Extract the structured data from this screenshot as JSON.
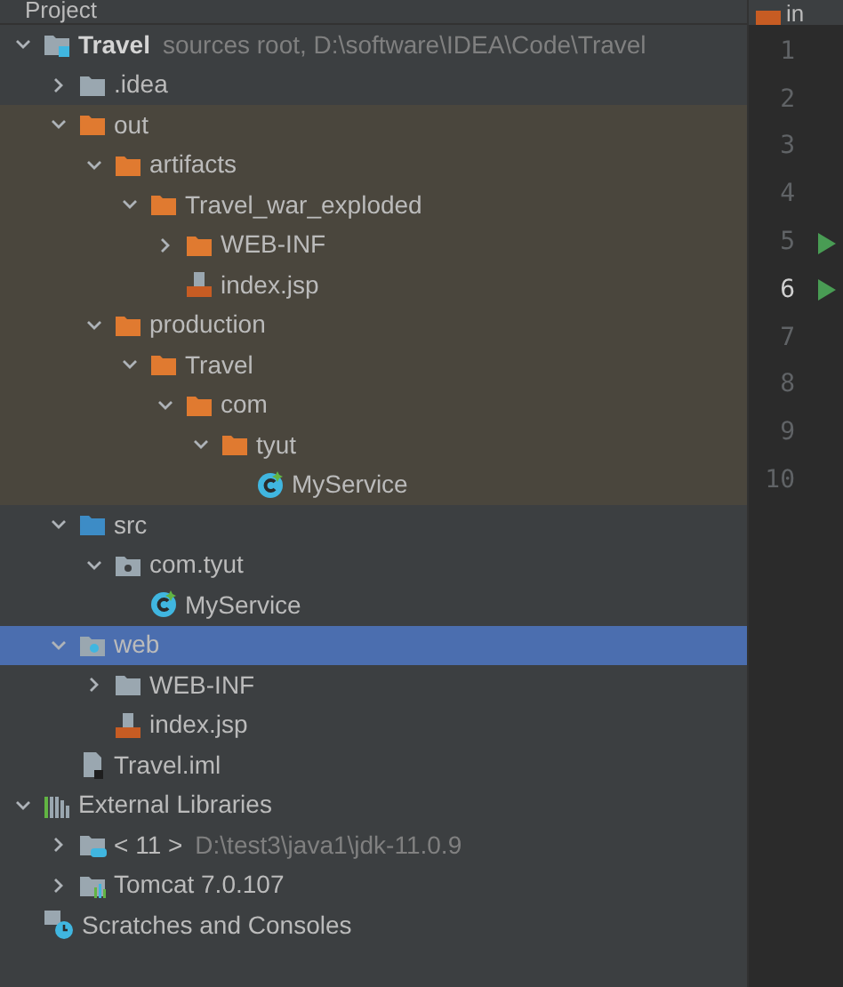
{
  "panel": {
    "title": "Project"
  },
  "tree": [
    {
      "label": "Travel",
      "detail": "sources root,  D:\\software\\IDEA\\Code\\Travel",
      "kind": "module",
      "expanded": true,
      "selected": false,
      "children": [
        {
          "label": ".idea",
          "kind": "folder",
          "expanded": false,
          "selected": false
        },
        {
          "label": "out",
          "kind": "excluded-folder",
          "excluded": true,
          "expanded": true,
          "selected": false,
          "children": [
            {
              "label": "artifacts",
              "kind": "excluded-folder",
              "expanded": true,
              "selected": false,
              "children": [
                {
                  "label": "Travel_war_exploded",
                  "kind": "excluded-folder",
                  "expanded": true,
                  "selected": false,
                  "children": [
                    {
                      "label": "WEB-INF",
                      "kind": "excluded-folder",
                      "expanded": false,
                      "selected": false
                    },
                    {
                      "label": "index.jsp",
                      "kind": "jsp",
                      "selected": false
                    }
                  ]
                }
              ]
            },
            {
              "label": "production",
              "kind": "excluded-folder",
              "expanded": true,
              "selected": false,
              "children": [
                {
                  "label": "Travel",
                  "kind": "excluded-folder",
                  "expanded": true,
                  "selected": false,
                  "children": [
                    {
                      "label": "com",
                      "kind": "excluded-folder",
                      "expanded": true,
                      "selected": false,
                      "children": [
                        {
                          "label": "tyut",
                          "kind": "excluded-folder",
                          "expanded": true,
                          "selected": false,
                          "children": [
                            {
                              "label": "MyService",
                              "kind": "class",
                              "selected": false
                            }
                          ]
                        }
                      ]
                    }
                  ]
                }
              ]
            }
          ]
        },
        {
          "label": "src",
          "kind": "source-folder",
          "expanded": true,
          "selected": false,
          "children": [
            {
              "label": "com.tyut",
              "kind": "package",
              "expanded": true,
              "selected": false,
              "children": [
                {
                  "label": "MyService",
                  "kind": "class",
                  "selected": false
                }
              ]
            }
          ]
        },
        {
          "label": "web",
          "kind": "web-folder",
          "expanded": true,
          "selected": true,
          "children": [
            {
              "label": "WEB-INF",
              "kind": "folder",
              "expanded": false,
              "selected": false
            },
            {
              "label": "index.jsp",
              "kind": "jsp",
              "selected": false
            }
          ]
        },
        {
          "label": "Travel.iml",
          "kind": "iml",
          "selected": false
        }
      ]
    },
    {
      "label": "External Libraries",
      "kind": "libraries",
      "expanded": true,
      "selected": false,
      "children": [
        {
          "label": "< 11 >",
          "detail": "D:\\test3\\java1\\jdk-11.0.9",
          "kind": "jdk",
          "expanded": false,
          "selected": false
        },
        {
          "label": "Tomcat 7.0.107",
          "kind": "tomcat",
          "expanded": false,
          "selected": false
        }
      ]
    },
    {
      "label": "Scratches and Consoles",
      "kind": "scratches",
      "selected": false
    }
  ],
  "editor": {
    "tab": "in",
    "lines": [
      {
        "number": "1",
        "current": false,
        "run": false
      },
      {
        "number": "2",
        "current": false,
        "run": false
      },
      {
        "number": "3",
        "current": false,
        "run": false
      },
      {
        "number": "4",
        "current": false,
        "run": false
      },
      {
        "number": "5",
        "current": false,
        "run": true
      },
      {
        "number": "6",
        "current": true,
        "run": true
      },
      {
        "number": "7",
        "current": false,
        "run": false
      },
      {
        "number": "8",
        "current": false,
        "run": false
      },
      {
        "number": "9",
        "current": false,
        "run": false
      },
      {
        "number": "10",
        "current": false,
        "run": false
      }
    ]
  }
}
